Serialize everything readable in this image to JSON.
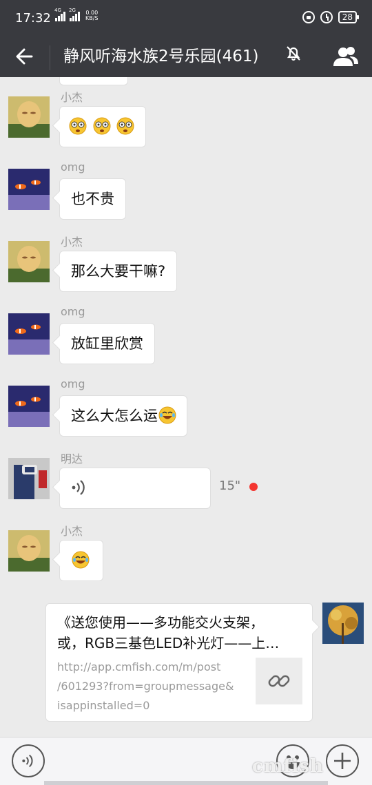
{
  "status_bar": {
    "time": "17:32",
    "signal1_tag": "4G",
    "signal2_tag": "2G",
    "speed_value": "0.00",
    "speed_unit": "KB/S",
    "battery": "28",
    "icons": [
      "lock-rotation-icon",
      "alarm-icon",
      "battery-icon"
    ]
  },
  "header": {
    "title": "静风听海水族2号乐园(461)",
    "icons": [
      "back-arrow-icon",
      "mute-bell-icon",
      "group-members-icon"
    ]
  },
  "messages": [
    {
      "sender": "小杰",
      "type": "emoji",
      "emoji": [
        "dizzy-face",
        "dizzy-face",
        "dizzy-face"
      ]
    },
    {
      "sender": "omg",
      "type": "text",
      "text": "也不贵"
    },
    {
      "sender": "小杰",
      "type": "text",
      "text": "那么大要干嘛?"
    },
    {
      "sender": "omg",
      "type": "text",
      "text": "放缸里欣赏"
    },
    {
      "sender": "omg",
      "type": "text",
      "text": "这么大怎么运",
      "emoji": [
        "rolling-laugh"
      ]
    },
    {
      "sender": "明达",
      "type": "voice",
      "duration": "15\"",
      "unread": true
    },
    {
      "sender": "小杰",
      "type": "emoji",
      "emoji": [
        "rolling-laugh"
      ]
    },
    {
      "sender": "self",
      "type": "link",
      "title_line1": "《送您使用——多功能交火支架，",
      "title_line2": "或，RGB三基色LED补光灯——上…",
      "url_line1": "http://app.cmfish.com/m/post",
      "url_line2": "/601293?from=groupmessage&",
      "url_line3": "isappinstalled=0"
    }
  ],
  "input_bar": {
    "icons": [
      "voice-input-icon",
      "emoji-picker-icon",
      "plus-more-icon"
    ]
  },
  "watermark": "cmfish",
  "colors": {
    "header_bg": "#393a3f",
    "chat_bg": "#ebebeb",
    "bubble_bg": "#ffffff",
    "unread_dot": "#f43530"
  }
}
